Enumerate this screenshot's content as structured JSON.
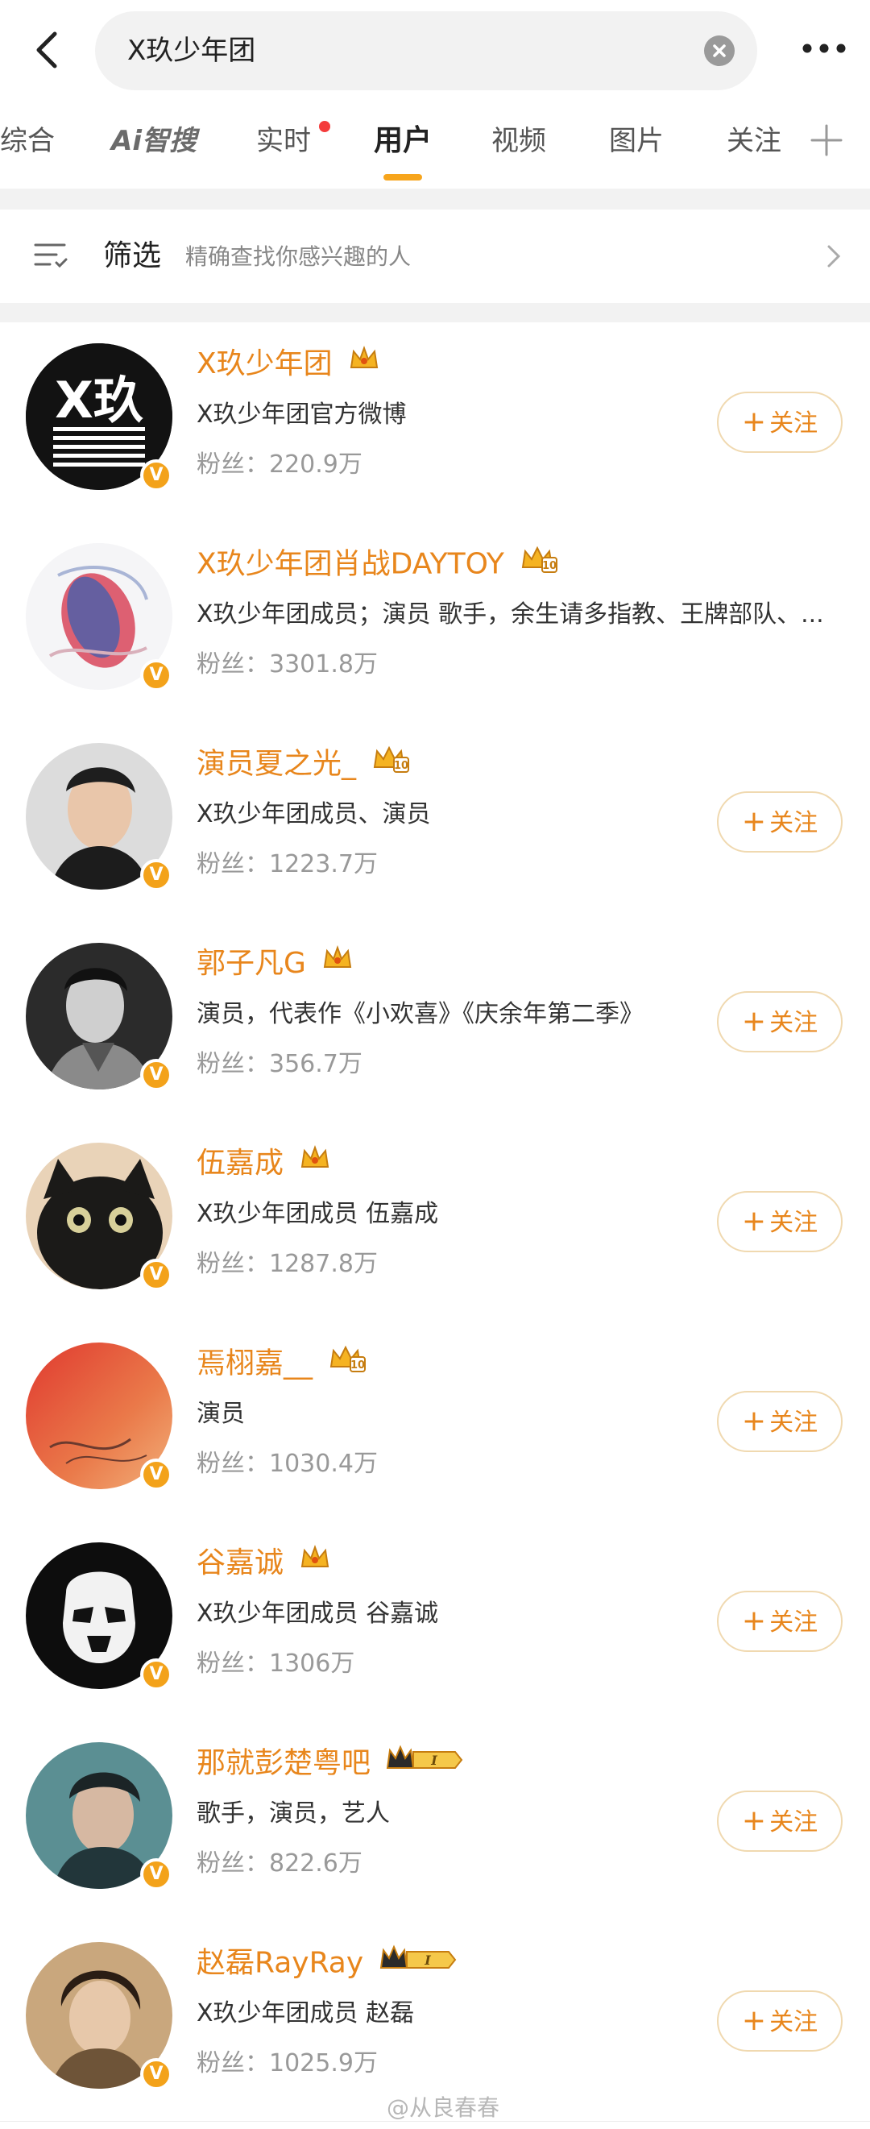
{
  "search": {
    "query": "X玖少年团"
  },
  "tabs": [
    {
      "label": "综合"
    },
    {
      "label": "Ai智搜"
    },
    {
      "label": "实时"
    },
    {
      "label": "用户"
    },
    {
      "label": "视频"
    },
    {
      "label": "图片"
    },
    {
      "label": "关注"
    }
  ],
  "active_tab": "用户",
  "filter": {
    "title": "筛选",
    "subtitle": "精确查找你感兴趣的人"
  },
  "follow_label": "关注",
  "users": [
    {
      "name": "X玖少年团",
      "desc": "X玖少年团官方微博",
      "fans": "粉丝：220.9万",
      "follow": true,
      "avatar": "logo-x9",
      "crown": "gold"
    },
    {
      "name": "X玖少年团肖战DAYTOY",
      "desc": "X玖少年团成员；演员 歌手，余生请多指教、王牌部队、...",
      "fans": "粉丝：3301.8万",
      "follow": false,
      "avatar": "art-light",
      "crown": "gold-lv"
    },
    {
      "name": "演员夏之光_",
      "desc": "X玖少年团成员、演员",
      "fans": "粉丝：1223.7万",
      "follow": true,
      "avatar": "portrait-light",
      "crown": "gold-lv"
    },
    {
      "name": "郭子凡G",
      "desc": "演员，代表作《小欢喜》《庆余年第二季》",
      "fans": "粉丝：356.7万",
      "follow": true,
      "avatar": "portrait-bw",
      "crown": "gold"
    },
    {
      "name": "伍嘉成",
      "desc": "X玖少年团成员 伍嘉成",
      "fans": "粉丝：1287.8万",
      "follow": true,
      "avatar": "cat",
      "crown": "gold"
    },
    {
      "name": "焉栩嘉__",
      "desc": "演员",
      "fans": "粉丝：1030.4万",
      "follow": true,
      "avatar": "painting-red",
      "crown": "gold-lv"
    },
    {
      "name": "谷嘉诚",
      "desc": "X玖少年团成员 谷嘉诚",
      "fans": "粉丝：1306万",
      "follow": true,
      "avatar": "trooper",
      "crown": "gold"
    },
    {
      "name": "那就彭楚粤吧",
      "desc": "歌手，演员，艺人",
      "fans": "粉丝：822.6万",
      "follow": true,
      "avatar": "portrait-teal",
      "crown": "level-1"
    },
    {
      "name": "赵磊RayRay",
      "desc": "X玖少年团成员 赵磊",
      "fans": "粉丝：1025.9万",
      "follow": true,
      "avatar": "portrait-warm",
      "crown": "level-1"
    }
  ],
  "watermark": "@从良春春",
  "colors": {
    "accent": "#e8861c",
    "verified": "#f3a21a",
    "tab_indicator": "#f7a51c"
  }
}
